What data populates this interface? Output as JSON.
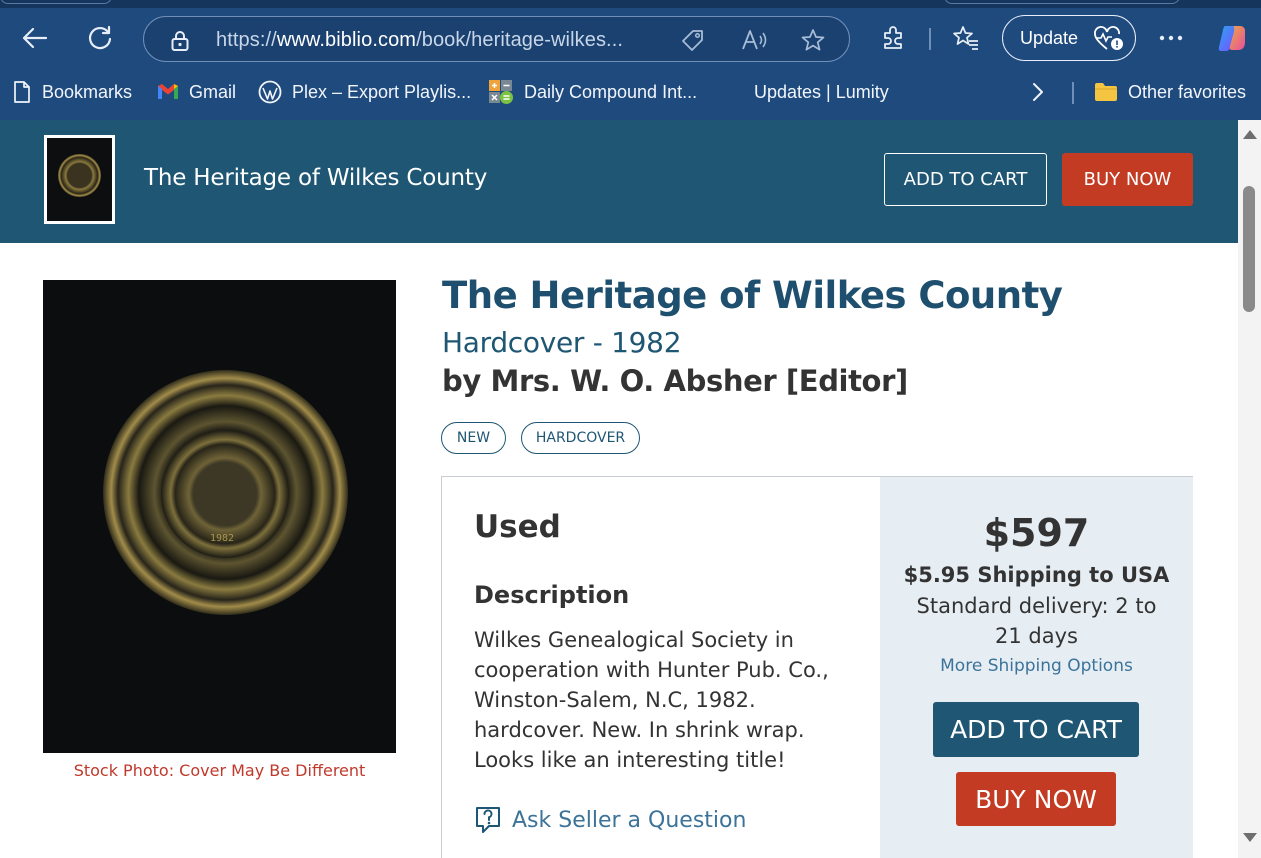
{
  "browser": {
    "url_prefix": "https://",
    "url_host": "www.biblio.com",
    "url_path": "/book/heritage-wilkes...",
    "update_label": "Update",
    "icons": [
      "back-icon",
      "refresh-icon",
      "lock-icon",
      "tag-icon",
      "read-aloud-icon",
      "star-icon",
      "extensions-icon",
      "favorites-icon",
      "heart-pulse-icon",
      "more-icon",
      "copilot-icon"
    ]
  },
  "bookmarks": {
    "items": [
      {
        "label": "Bookmarks",
        "icon": "page-icon"
      },
      {
        "label": "Gmail",
        "icon": "gmail-icon"
      },
      {
        "label": "Plex – Export Playlis...",
        "icon": "wordpress-icon"
      },
      {
        "label": "Daily Compound Int...",
        "icon": "calculator-icon"
      },
      {
        "label": "Updates | Lumity",
        "icon": ""
      }
    ],
    "other_label": "Other favorites"
  },
  "sticky": {
    "title": "The Heritage of Wilkes County",
    "add_to_cart": "ADD TO CART",
    "buy_now": "BUY NOW"
  },
  "book": {
    "title": "The Heritage of Wilkes County",
    "format_line": "Hardcover - 1982",
    "author_line": "by Mrs. W. O. Absher [Editor]",
    "tags": [
      "NEW",
      "HARDCOVER"
    ],
    "cover_caption": "Stock Photo: Cover May Be Different",
    "cover_year": "1982"
  },
  "listing": {
    "condition": "Used",
    "description_heading": "Description",
    "description": "Wilkes Genealogical Society in cooperation with Hunter Pub. Co., Winston-Salem, N.C, 1982. hardcover. New. In shrink wrap. Looks like an interesting title!",
    "ask_seller": "Ask Seller a Question",
    "price": "$597",
    "shipping": "$5.95 Shipping to USA",
    "delivery": "Standard delivery: 2 to 21 days",
    "more_shipping": "More Shipping Options",
    "add_to_cart": "ADD TO CART",
    "buy_now": "BUY NOW"
  },
  "colors": {
    "brand_teal": "#1e5673",
    "buy_red": "#c23b22",
    "chrome_blue": "#1f4a7e"
  }
}
